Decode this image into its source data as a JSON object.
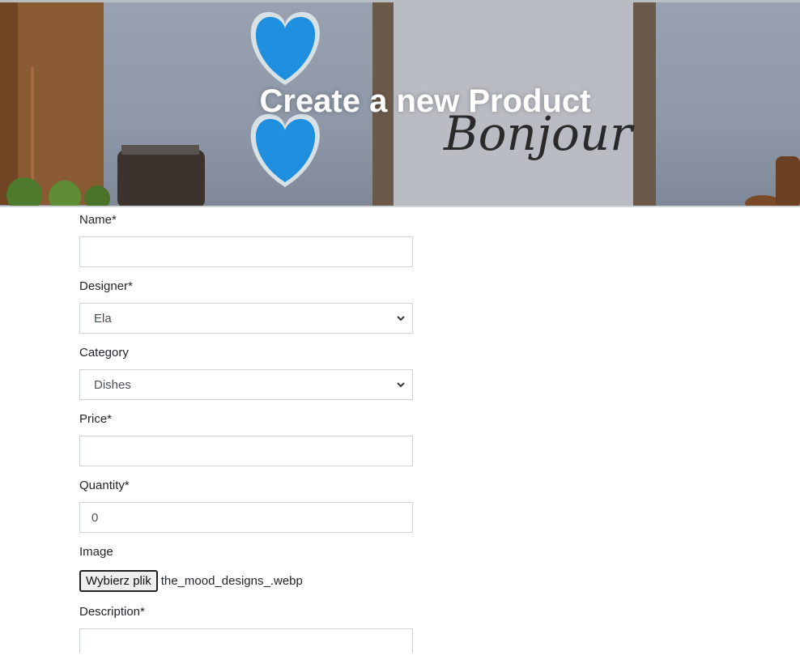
{
  "hero": {
    "title": "Create a new Product",
    "decor_text": "Bonjour"
  },
  "form": {
    "name": {
      "label": "Name*",
      "value": ""
    },
    "designer": {
      "label": "Designer*",
      "selected": "Ela"
    },
    "category": {
      "label": "Category",
      "selected": "Dishes"
    },
    "price": {
      "label": "Price*",
      "value": ""
    },
    "quantity": {
      "label": "Quantity*",
      "value": "0"
    },
    "image": {
      "label": "Image",
      "button": "Wybierz plik",
      "filename": "the_mood_designs_.webp"
    },
    "description": {
      "label": "Description*",
      "value": ""
    }
  },
  "colors": {
    "heart": "#1f8fe0",
    "wall": "#939dac",
    "wood": "#8a5a32"
  }
}
